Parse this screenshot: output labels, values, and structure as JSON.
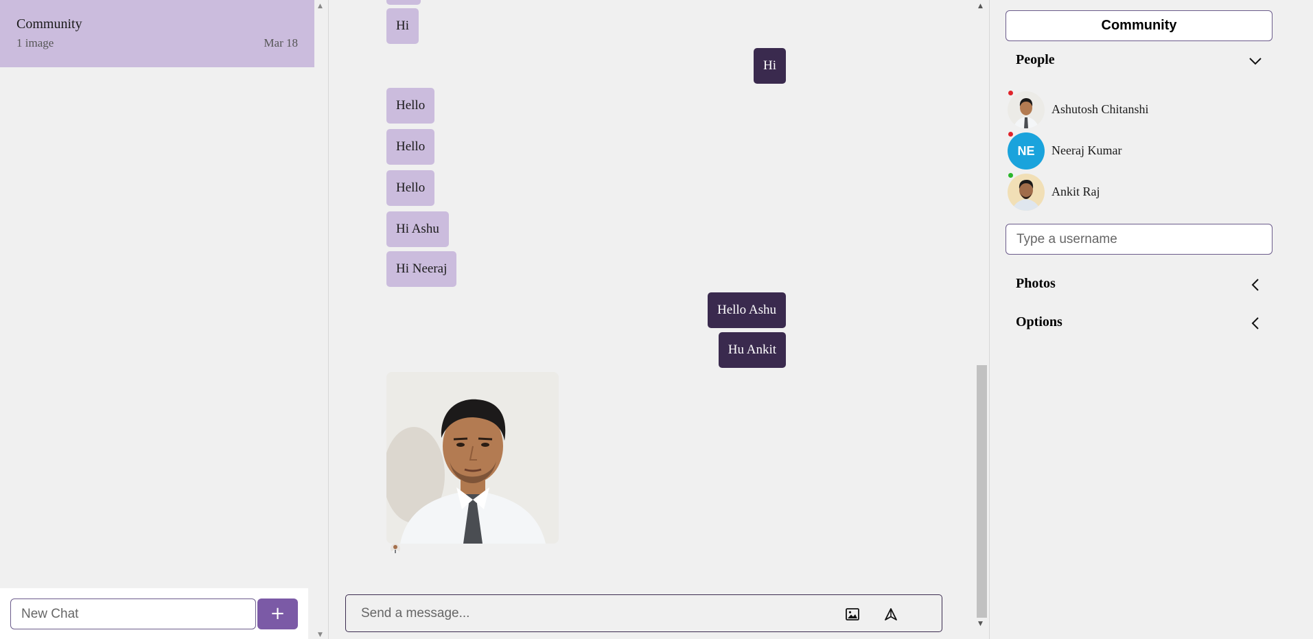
{
  "sidebar": {
    "chats": [
      {
        "name": "Community",
        "preview": "1 image",
        "date": "Mar 18"
      }
    ],
    "new_chat_placeholder": "New Chat",
    "add_label": "+"
  },
  "messages": [
    {
      "text": "Hi",
      "direction": "incoming"
    },
    {
      "text": "Hi",
      "direction": "outgoing"
    },
    {
      "text": "Hello",
      "direction": "incoming"
    },
    {
      "text": "Hello",
      "direction": "incoming"
    },
    {
      "text": "Hello",
      "direction": "incoming"
    },
    {
      "text": "Hi Ashu",
      "direction": "incoming"
    },
    {
      "text": "Hi Neeraj",
      "direction": "incoming"
    },
    {
      "text": "Hello Ashu",
      "direction": "outgoing"
    },
    {
      "text": "Hu Ankit",
      "direction": "outgoing"
    }
  ],
  "composer": {
    "placeholder": "Send a message...",
    "image_icon": "image-icon",
    "send_icon": "send-icon"
  },
  "details": {
    "title": "Community",
    "sections": {
      "people": "People",
      "photos": "Photos",
      "options": "Options"
    },
    "people": [
      {
        "name": "Ashutosh Chitanshi",
        "status": "offline",
        "status_color": "#e0242b"
      },
      {
        "name": "Neeraj Kumar",
        "initials": "NE",
        "status": "offline",
        "status_color": "#e0242b"
      },
      {
        "name": "Ankit Raj",
        "status": "online",
        "status_color": "#2bb62b"
      }
    ],
    "username_placeholder": "Type a username"
  },
  "colors": {
    "incoming_bubble": "#cbbcdd",
    "outgoing_bubble": "#3a2a4e",
    "accent": "#7b5aa6"
  }
}
